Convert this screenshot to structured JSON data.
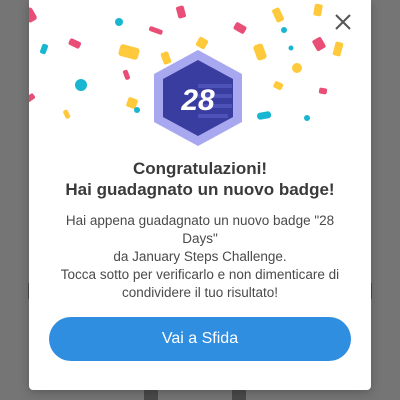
{
  "modal": {
    "close_label": "close",
    "badge_number": "28",
    "title_line1": "Congratulazioni!",
    "title_line2": "Hai guadagnato un nuovo badge!",
    "body_lines": [
      "Hai appena guadagnato un nuovo badge \"28",
      "Days\"",
      "da January Steps Challenge.",
      "Tocca sotto per verificarlo e non dimenticare di",
      "condividere il tuo risultato!"
    ],
    "cta_label": "Vai a Sfida"
  },
  "colors": {
    "accent": "#2f8ee0",
    "badge_outer": "#a8a8f0",
    "badge_inner": "#3a3da0",
    "overlay": "#757575"
  },
  "icons": {
    "close": "close-icon",
    "badge": "badge-28-icon"
  }
}
